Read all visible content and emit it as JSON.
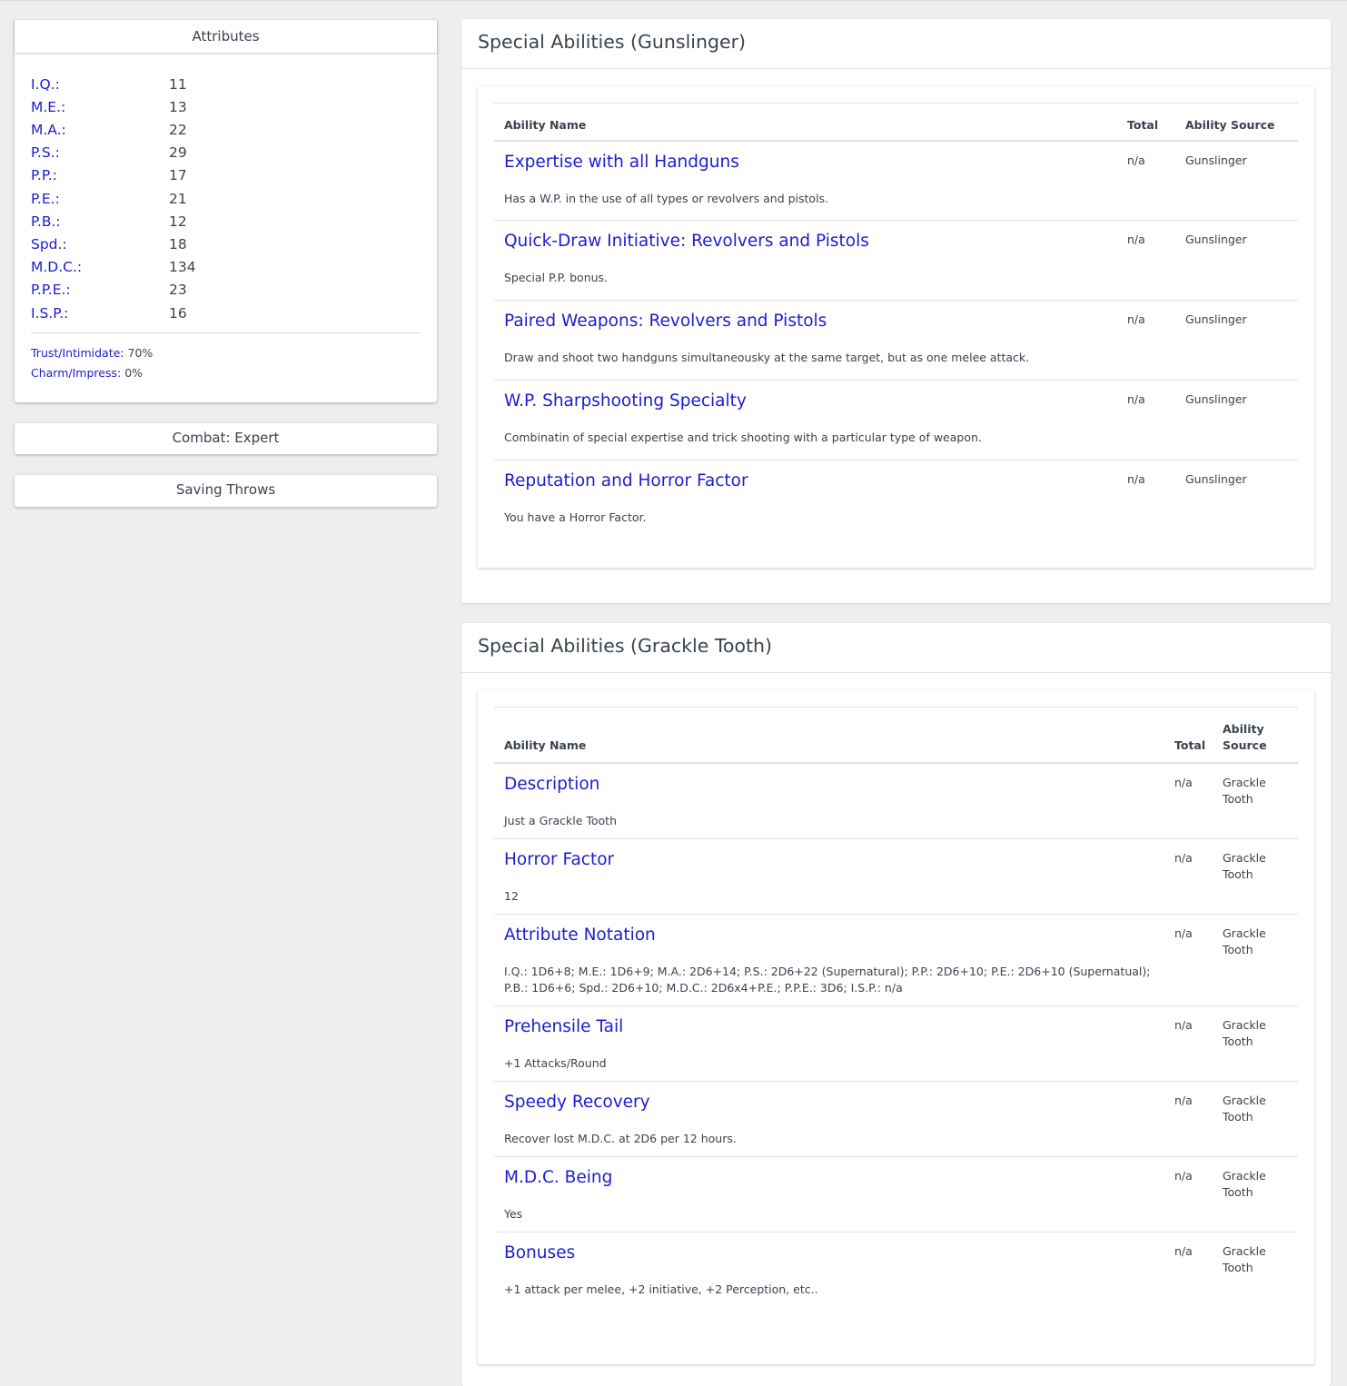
{
  "attributes": {
    "title": "Attributes",
    "items": [
      {
        "label": "I.Q.:",
        "value": "11"
      },
      {
        "label": "M.E.:",
        "value": "13"
      },
      {
        "label": "M.A.:",
        "value": "22"
      },
      {
        "label": "P.S.:",
        "value": "29"
      },
      {
        "label": "P.P.:",
        "value": "17"
      },
      {
        "label": "P.E.:",
        "value": "21"
      },
      {
        "label": "P.B.:",
        "value": "12"
      },
      {
        "label": "Spd.:",
        "value": "18"
      },
      {
        "label": "M.D.C.:",
        "value": "134"
      },
      {
        "label": "P.P.E.:",
        "value": "23"
      },
      {
        "label": "I.S.P.:",
        "value": "16"
      }
    ],
    "trust_label": "Trust/Intimidate:",
    "trust_value": "70%",
    "charm_label": "Charm/Impress:",
    "charm_value": "0%"
  },
  "combat": {
    "title": "Combat: Expert"
  },
  "saving_throws": {
    "title": "Saving Throws"
  },
  "gunslinger": {
    "title": "Special Abilities (Gunslinger)",
    "headers": {
      "name": "Ability Name",
      "total": "Total",
      "source": "Ability Source"
    },
    "rows": [
      {
        "name": "Expertise with all Handguns",
        "desc": "Has a W.P. in the use of all types or revolvers and pistols.",
        "total": "n/a",
        "source": "Gunslinger"
      },
      {
        "name": "Quick-Draw Initiative: Revolvers and Pistols",
        "desc": "Special P.P. bonus.",
        "total": "n/a",
        "source": "Gunslinger"
      },
      {
        "name": "Paired Weapons: Revolvers and Pistols",
        "desc": "Draw and shoot two handguns simultaneousky at the same target, but as one melee attack.",
        "total": "n/a",
        "source": "Gunslinger"
      },
      {
        "name": "W.P. Sharpshooting Specialty",
        "desc": "Combinatin of special expertise and trick shooting with a particular type of weapon.",
        "total": "n/a",
        "source": "Gunslinger"
      },
      {
        "name": "Reputation and Horror Factor",
        "desc": "You have a Horror Factor.",
        "total": "n/a",
        "source": "Gunslinger"
      }
    ]
  },
  "grackle": {
    "title": "Special Abilities (Grackle Tooth)",
    "headers": {
      "name": "Ability Name",
      "total": "Total",
      "source": "Ability Source"
    },
    "rows": [
      {
        "name": "Description",
        "desc": "Just a Grackle Tooth",
        "total": "n/a",
        "source": "Grackle Tooth"
      },
      {
        "name": "Horror Factor",
        "desc": "12",
        "total": "n/a",
        "source": "Grackle Tooth"
      },
      {
        "name": "Attribute Notation",
        "desc": "I.Q.: 1D6+8; M.E.: 1D6+9; M.A.: 2D6+14; P.S.: 2D6+22 (Supernatural); P.P.: 2D6+10; P.E.: 2D6+10 (Supernatual); P.B.: 1D6+6; Spd.: 2D6+10; M.D.C.: 2D6x4+P.E.; P.P.E.: 3D6; I.S.P.: n/a",
        "total": "n/a",
        "source": "Grackle Tooth"
      },
      {
        "name": "Prehensile Tail",
        "desc": "+1 Attacks/Round",
        "total": "n/a",
        "source": "Grackle Tooth"
      },
      {
        "name": "Speedy Recovery",
        "desc": "Recover lost M.D.C. at 2D6 per 12 hours.",
        "total": "n/a",
        "source": "Grackle Tooth"
      },
      {
        "name": "M.D.C. Being",
        "desc": "Yes",
        "total": "n/a",
        "source": "Grackle Tooth"
      },
      {
        "name": "Bonuses",
        "desc": "+1 attack per melee, +2 initiative, +2 Perception, etc..",
        "total": "n/a",
        "source": "Grackle Tooth"
      }
    ]
  }
}
